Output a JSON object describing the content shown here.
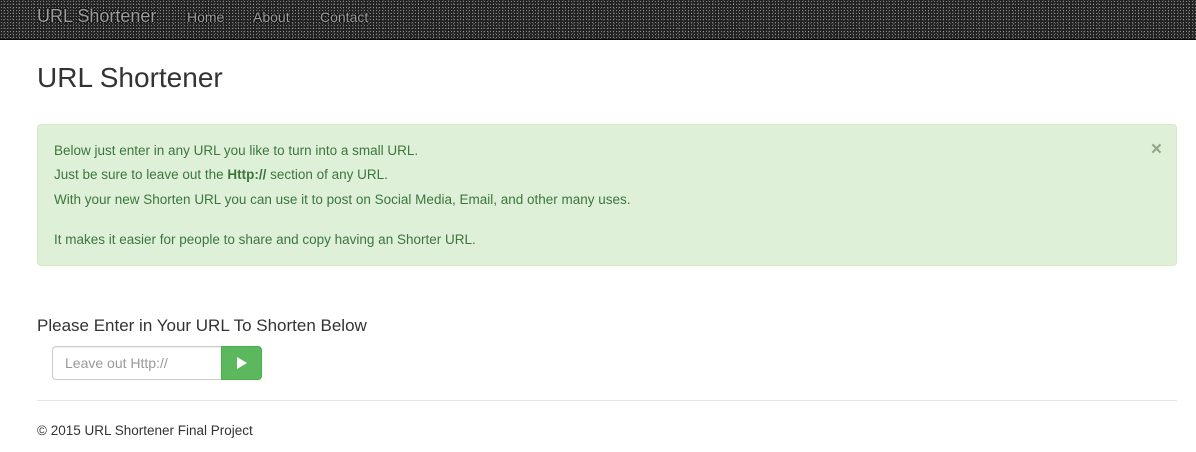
{
  "navbar": {
    "brand": "URL Shortener",
    "links": [
      "Home",
      "About",
      "Contact"
    ]
  },
  "page": {
    "title": "URL Shortener"
  },
  "alert": {
    "line1": "Below just enter in any URL you like to turn into a small URL.",
    "line2_before": "Just be sure to leave out the ",
    "line2_bold": "Http://",
    "line2_after": " section of any URL.",
    "line3": "With your new Shorten URL you can use it to post on Social Media, Email, and other many uses.",
    "line4": "It makes it easier for people to share and copy having an Shorter URL.",
    "close_symbol": "×"
  },
  "form": {
    "heading": "Please Enter in Your URL To Shorten Below",
    "input_placeholder": "Leave out Http://",
    "input_value": "",
    "submit_icon": "play-icon"
  },
  "footer": {
    "text": "© 2015 URL Shortener Final Project"
  },
  "colors": {
    "alert_background": "#dff0d8",
    "alert_text": "#3c763d",
    "button_green": "#5cb85c",
    "navbar_dark": "#222222"
  }
}
